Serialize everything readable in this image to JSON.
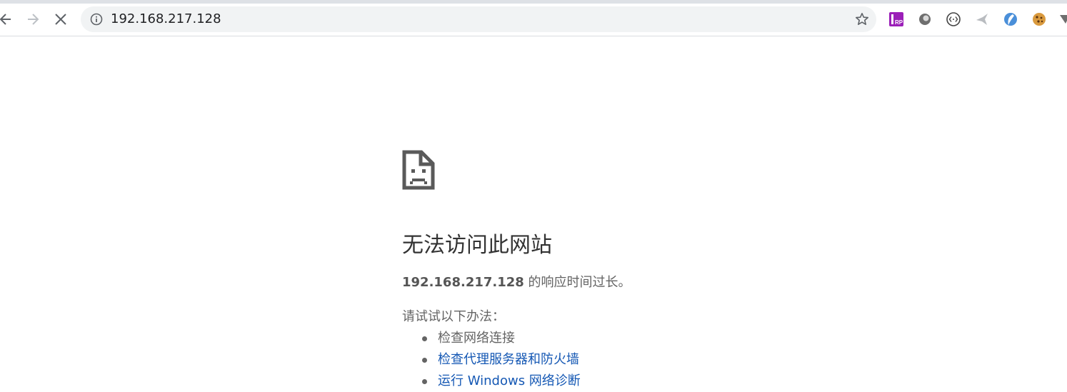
{
  "browser": {
    "url": "192.168.217.128",
    "back_icon": "back-arrow-icon",
    "forward_icon": "forward-arrow-icon",
    "stop_icon": "close-icon",
    "info_icon": "info-icon",
    "bookmark_icon": "star-icon",
    "extensions": [
      {
        "name": "axure-rp-extension-icon",
        "label": "RP",
        "color": "#9b1fb8"
      },
      {
        "name": "circle-extension-icon"
      },
      {
        "name": "code-extension-icon"
      },
      {
        "name": "bird-extension-icon"
      },
      {
        "name": "feather-extension-icon"
      },
      {
        "name": "cookie-extension-icon"
      },
      {
        "name": "filter-extension-icon"
      }
    ]
  },
  "error_page": {
    "icon": "sad-document-icon",
    "title": "无法访问此网站",
    "host": "192.168.217.128",
    "summary_rest": " 的响应时间过长。",
    "suggestions_heading": "请试试以下办法：",
    "suggestions": [
      {
        "text": "检查网络连接",
        "is_link": false
      },
      {
        "text": "检查代理服务器和防火墙",
        "is_link": true
      },
      {
        "text": "运行 Windows 网络诊断",
        "is_link": true
      }
    ],
    "link_color": "#1558b4"
  }
}
